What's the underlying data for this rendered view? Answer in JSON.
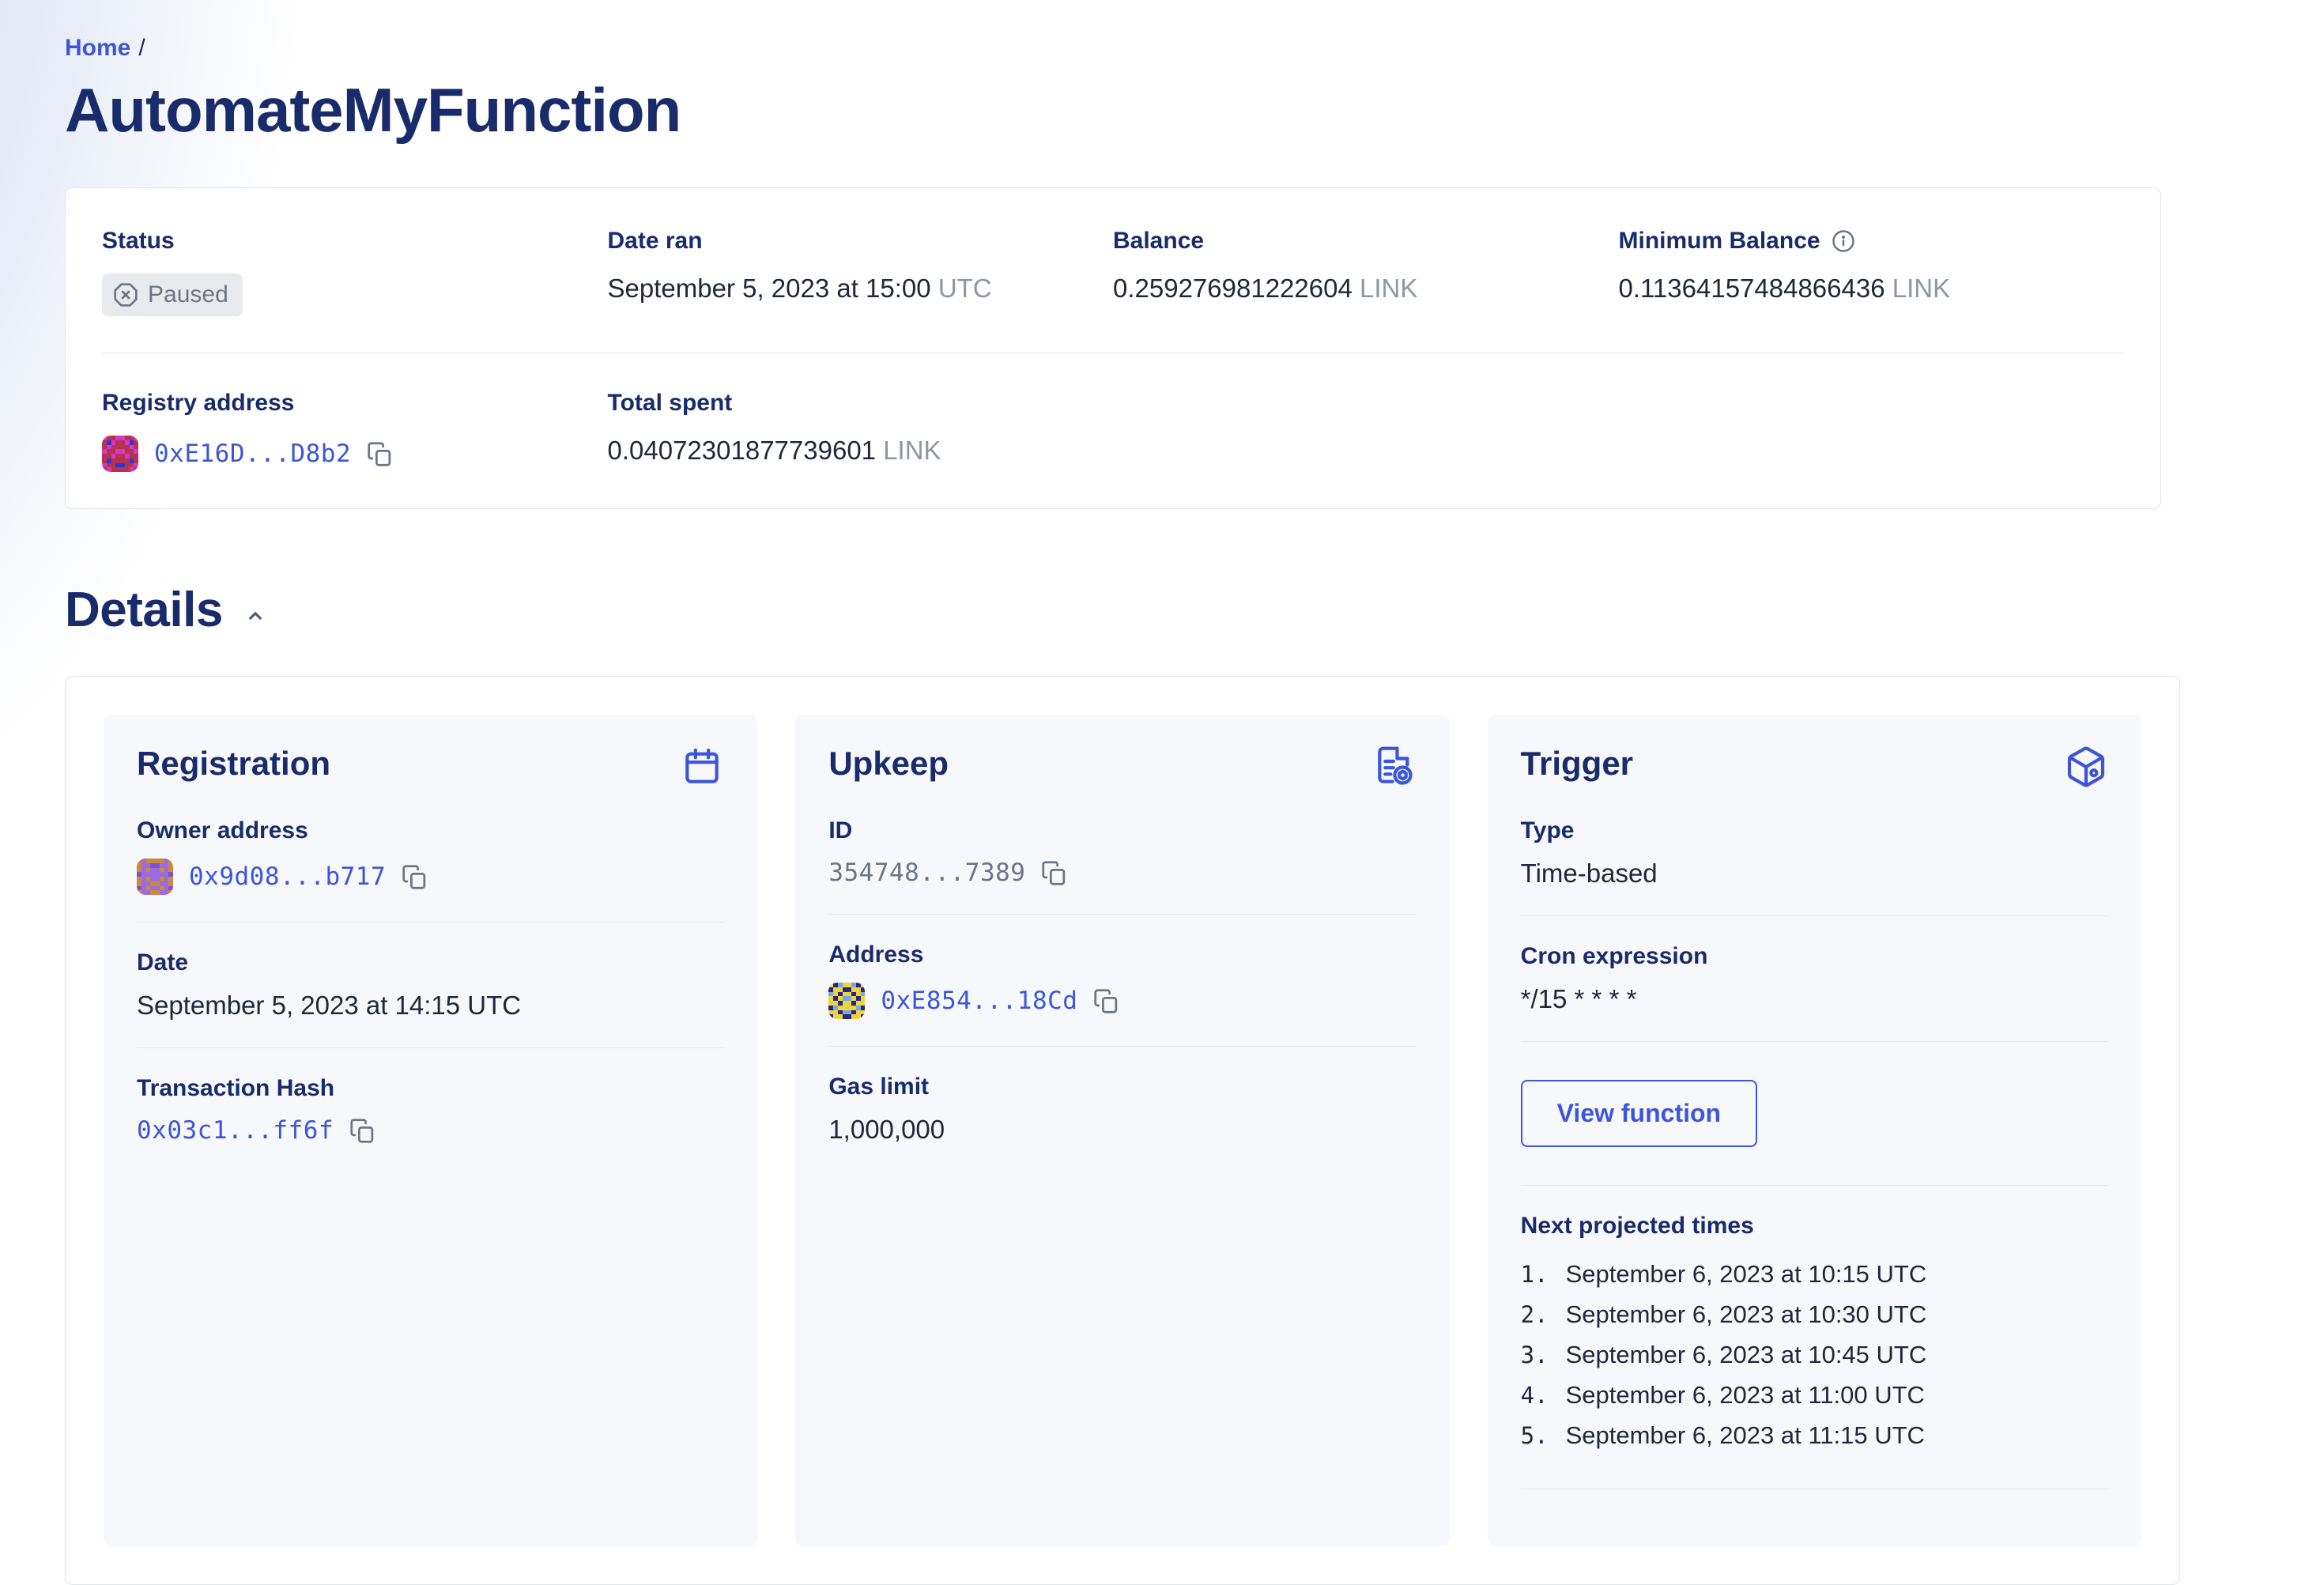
{
  "breadcrumb": {
    "home": "Home",
    "separator": "/"
  },
  "title": "AutomateMyFunction",
  "summary": {
    "status": {
      "label": "Status",
      "value": "Paused"
    },
    "date_ran": {
      "label": "Date ran",
      "value": "September 5, 2023 at 15:00",
      "unit": "UTC"
    },
    "balance": {
      "label": "Balance",
      "value": "0.259276981222604",
      "unit": "LINK"
    },
    "min_balance": {
      "label": "Minimum Balance",
      "value": "0.11364157484866436",
      "unit": "LINK"
    },
    "registry": {
      "label": "Registry address",
      "address": "0xE16D...D8b2"
    },
    "total_spent": {
      "label": "Total spent",
      "value": "0.04072301877739601",
      "unit": "LINK"
    }
  },
  "details": {
    "heading": "Details",
    "registration": {
      "title": "Registration",
      "owner": {
        "label": "Owner address",
        "address": "0x9d08...b717"
      },
      "date": {
        "label": "Date",
        "value": "September 5, 2023 at 14:15 UTC"
      },
      "tx": {
        "label": "Transaction Hash",
        "value": "0x03c1...ff6f"
      }
    },
    "upkeep": {
      "title": "Upkeep",
      "id": {
        "label": "ID",
        "value": "354748...7389"
      },
      "address": {
        "label": "Address",
        "value": "0xE854...18Cd"
      },
      "gas": {
        "label": "Gas limit",
        "value": "1,000,000"
      }
    },
    "trigger": {
      "title": "Trigger",
      "type": {
        "label": "Type",
        "value": "Time-based"
      },
      "cron": {
        "label": "Cron expression",
        "value": "*/15 * * * *"
      },
      "view_function_label": "View function",
      "next": {
        "label": "Next projected times",
        "items": [
          {
            "n": "1.",
            "text": "September 6, 2023 at 10:15 UTC"
          },
          {
            "n": "2.",
            "text": "September 6, 2023 at 10:30 UTC"
          },
          {
            "n": "3.",
            "text": "September 6, 2023 at 10:45 UTC"
          },
          {
            "n": "4.",
            "text": "September 6, 2023 at 11:00 UTC"
          },
          {
            "n": "5.",
            "text": "September 6, 2023 at 11:15 UTC"
          }
        ]
      }
    }
  },
  "colors": {
    "accent_blue": "#3d55d8",
    "heading_navy": "#1a2b6b",
    "value_dark": "#21263c",
    "muted_gray": "#6d7484",
    "unit_gray": "#8f95a5",
    "card_bg": "#f7f8fb",
    "badge_bg": "#e9eaee"
  },
  "avatars": {
    "registry": {
      "colors": [
        "#d836c8",
        "#b4344f",
        "#3434cf"
      ],
      "pattern": [
        "01100110",
        "12011021",
        "10111101",
        "01100110",
        "11011011",
        "12111121",
        "01122110",
        "10111101"
      ]
    },
    "owner": {
      "colors": [
        "#c98a3e",
        "#9a6ce0",
        "#8050d0"
      ],
      "pattern": [
        "01000010",
        "01122110",
        "01011010",
        "21111112",
        "01011010",
        "01100110",
        "21011012",
        "01100110"
      ]
    },
    "upkeep": {
      "colors": [
        "#2a2782",
        "#ecd53e",
        "#7aa7e8"
      ],
      "pattern": [
        "10211201",
        "01100110",
        "21011012",
        "10122101",
        "11011011",
        "02111120",
        "11022011",
        "01100110"
      ]
    }
  }
}
